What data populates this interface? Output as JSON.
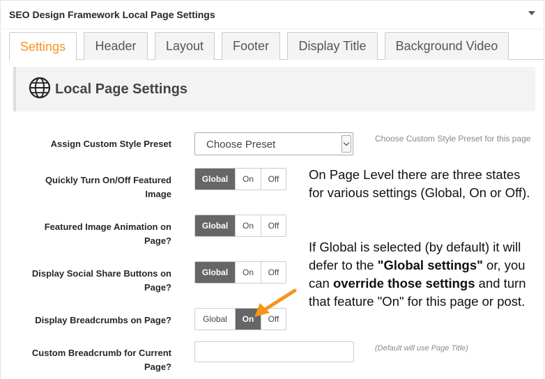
{
  "panel": {
    "title": "SEO Design Framework Local Page Settings"
  },
  "tabs": [
    {
      "label": "Settings",
      "active": true
    },
    {
      "label": "Header",
      "active": false
    },
    {
      "label": "Layout",
      "active": false
    },
    {
      "label": "Footer",
      "active": false
    },
    {
      "label": "Display Title",
      "active": false
    },
    {
      "label": "Background Video",
      "active": false
    }
  ],
  "section": {
    "title": "Local Page Settings",
    "icon": "globe-icon"
  },
  "fields": {
    "preset": {
      "label": "Assign Custom Style Preset",
      "value": "Choose Preset",
      "help": "Choose Custom Style Preset for this page"
    },
    "featured_image": {
      "label": "Quickly Turn On/Off Featured Image",
      "selected": "Global"
    },
    "featured_animation": {
      "label": "Featured Image Animation on Page?",
      "selected": "Global"
    },
    "social_share": {
      "label": "Display Social Share Buttons on Page?",
      "selected": "Global"
    },
    "breadcrumbs": {
      "label": "Display Breadcrumbs on Page?",
      "selected": "On"
    },
    "custom_breadcrumb": {
      "label": "Custom Breadcrumb for Current Page?",
      "value": "",
      "help": "(Default will use Page Title)"
    }
  },
  "segment_options": {
    "global": "Global",
    "on": "On",
    "off": "Off"
  },
  "callout": {
    "p1": "On Page Level there are three states for various settings (Global, On or Off).",
    "p2_a": "If Global is selected (by default) it will defer to the ",
    "p2_b": "\"Global settings\"",
    "p2_c": " or, you can ",
    "p2_d": "override those settings",
    "p2_e": " and turn that feature \"On\" for this page or post."
  },
  "colors": {
    "accent": "#f7941d",
    "selected_segment": "#666666",
    "arrow": "#f7941d"
  }
}
